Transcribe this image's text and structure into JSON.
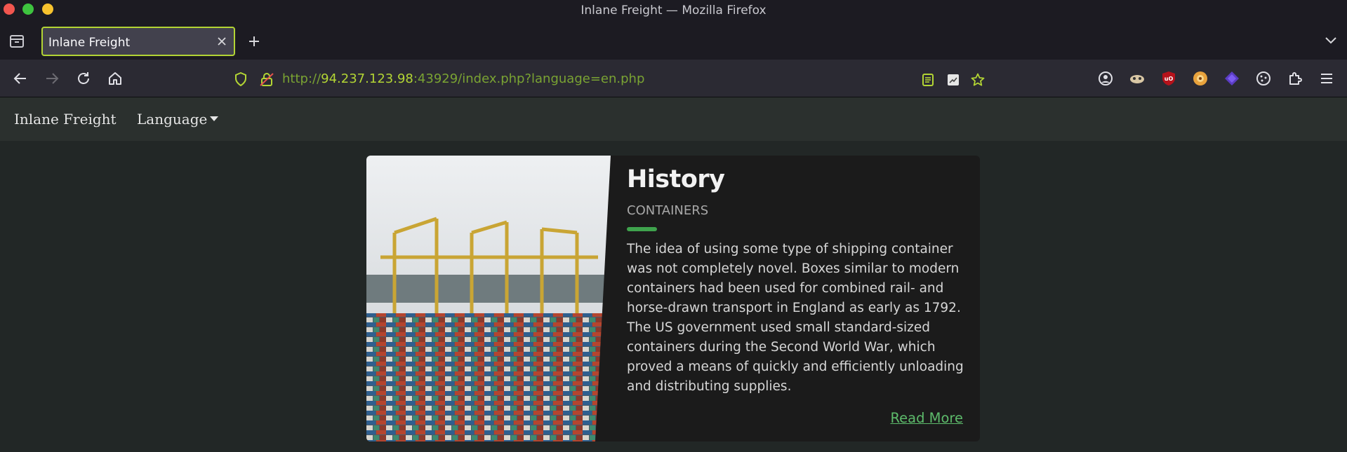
{
  "window": {
    "title": "Inlane Freight — Mozilla Firefox"
  },
  "tabs": [
    {
      "label": "Inlane Freight",
      "active": true
    }
  ],
  "urlbar": {
    "scheme": "http://",
    "host": "94.237.123.98",
    "rest": ":43929/index.php?language=en.php"
  },
  "toolbar_icons": [
    "back-icon",
    "forward-icon",
    "reload-icon",
    "home-icon",
    "shield-icon",
    "insecure-lock-icon",
    "reader-view-icon",
    "page-action-icon",
    "bookmark-star-icon"
  ],
  "extensions": [
    "account-icon",
    "extension-1-icon",
    "ublock-origin-icon",
    "extension-3-icon",
    "extension-4-icon",
    "cookie-icon",
    "extensions-puzzle-icon",
    "menu-icon"
  ],
  "site": {
    "brand": "Inlane Freight",
    "nav": {
      "language_label": "Language"
    }
  },
  "card": {
    "title": "History",
    "subtitle": "CONTAINERS",
    "text": "The idea of using some type of shipping container was not completely novel. Boxes similar to modern containers had been used for combined rail- and horse-drawn transport in England as early as 1792. The US government used small standard-sized containers during the Second World War, which proved a means of quickly and efficiently unloading and distributing supplies.",
    "link": "Read More",
    "accent_color": "#3fa34d"
  },
  "colors": {
    "brand_accent": "#b3d534",
    "page_bg": "#222726",
    "card_bg": "#1b1b1b",
    "link": "#5dbb6b"
  }
}
